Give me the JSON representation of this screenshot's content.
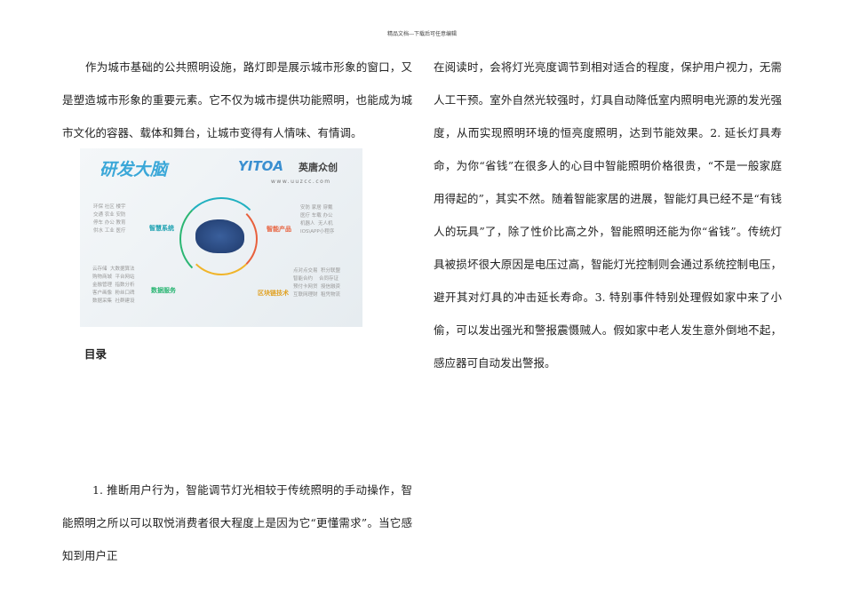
{
  "header": "精品文档---下载后可任意编辑",
  "left_paragraph": "作为城市基础的公共照明设施，路灯即是展示城市形象的窗口，又是塑造城市形象的重要元素。它不仅为城市提供功能照明，也能成为城市文化的容器、载体和舞台，让城市变得有人情味、有情调。",
  "image": {
    "title": "研发大脑",
    "logo": "YITOA",
    "logo_cn": "英唐众创",
    "url": "www.uuzcc.com",
    "q1_label": "智慧系统",
    "q1_items": "环保 社区 楼宇\n交通 农业 安防\n停车 办公 教育\n供水 工业 医疗",
    "q2_label": "智能产品",
    "q2_items": "安防 家居 穿戴\n医疗 车载 办公\n机器人  无人机\nIOS\\APP小程序",
    "q3_label": "数据服务",
    "q3_items": "云存储  大数据算法\n购物商城  平台网站\n金融管理  指数分析\n客户画像  粉丝口碑\n数据采集  社群建设",
    "q4_label": "区块链技术",
    "q4_items": "点对点交易  积分联盟\n智能合约    合同存证\n预付卡网贷  授信融资\n互联网理财  租凭物流"
  },
  "toc_title": "目录",
  "left_paragraph_2": "1. 推断用户行为，智能调节灯光相较于传统照明的手动操作，智能照明之所以可以取悦消费者很大程度上是因为它“更懂需求”。当它感知到用户正",
  "right_paragraph": "在阅读时，会将灯光亮度调节到相对适合的程度，保护用户视力，无需人工干预。室外自然光较强时，灯具自动降低室内照明电光源的发光强度，从而实现照明环境的恒亮度照明，达到节能效果。2. 延长灯具寿命，为你“省钱”在很多人的心目中智能照明价格很贵，“不是一般家庭用得起的”，其实不然。随着智能家居的进展，智能灯具已经不是“有钱人的玩具”了，除了性价比高之外，智能照明还能为你“省钱”。传统灯具被损坏很大原因是电压过高，智能灯光控制则会通过系统控制电压，避开其对灯具的冲击延长寿命。3. 特别事件特别处理假如家中来了小偷，可以发出强光和警报震慑贼人。假如家中老人发生意外倒地不起，感应器可自动发出警报。"
}
